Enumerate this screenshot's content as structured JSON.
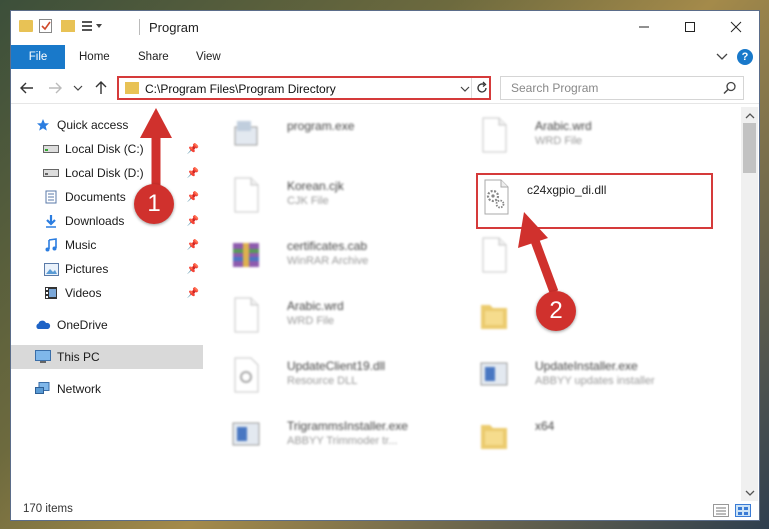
{
  "window": {
    "title": "Program"
  },
  "ribbon": {
    "tabs": [
      "File",
      "Home",
      "Share",
      "View"
    ]
  },
  "address": {
    "path": "C:\\Program Files\\Program Directory"
  },
  "search": {
    "placeholder": "Search Program"
  },
  "sidebar": {
    "items": [
      {
        "label": "Quick access",
        "icon": "star-icon",
        "pinned": false
      },
      {
        "label": "Local Disk (C:)",
        "icon": "drive-icon",
        "pinned": true
      },
      {
        "label": "Local Disk (D:)",
        "icon": "drive-icon",
        "pinned": true
      },
      {
        "label": "Documents",
        "icon": "documents-icon",
        "pinned": true
      },
      {
        "label": "Downloads",
        "icon": "download-icon",
        "pinned": true
      },
      {
        "label": "Music",
        "icon": "music-icon",
        "pinned": true
      },
      {
        "label": "Pictures",
        "icon": "pictures-icon",
        "pinned": true
      },
      {
        "label": "Videos",
        "icon": "videos-icon",
        "pinned": true
      },
      {
        "label": "OneDrive",
        "icon": "cloud-icon",
        "pinned": false
      },
      {
        "label": "This PC",
        "icon": "computer-icon",
        "pinned": false,
        "selected": true
      },
      {
        "label": "Network",
        "icon": "network-icon",
        "pinned": false
      }
    ]
  },
  "files": [
    {
      "name": "program.exe",
      "type": ""
    },
    {
      "name": "Arabic.wrd",
      "type": "WRD File"
    },
    {
      "name": "Korean.cjk",
      "type": "CJK File"
    },
    {
      "name": "c24xgpio_di.dll",
      "type": ""
    },
    {
      "name": "certificates.cab",
      "type": "WinRAR Archive"
    },
    {
      "name": "Arabic.wrd",
      "type": "WRD File"
    },
    {
      "name": "UpdateClient19.dll",
      "type": "Resource DLL"
    },
    {
      "name": "UpdateInstaller.exe",
      "type": "ABBYY updates installer"
    },
    {
      "name": "TrigrammsInstaller.exe",
      "type": "ABBYY Trimmoder tr..."
    },
    {
      "name": "x64",
      "type": ""
    }
  ],
  "annotations": {
    "step1": "1",
    "step2": "2"
  },
  "status": {
    "count": "170 items"
  },
  "colors": {
    "accent": "#1979ca",
    "highlight": "#d53a3a",
    "badge": "#d0312d"
  }
}
